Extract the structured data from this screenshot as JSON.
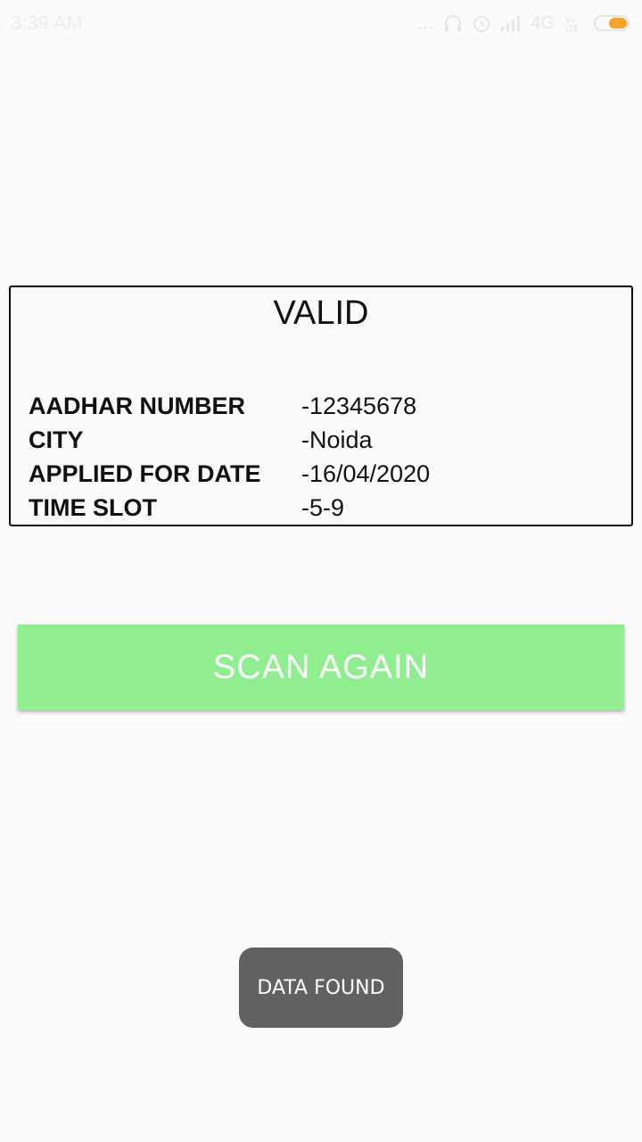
{
  "status_bar": {
    "time": "3:39 AM",
    "dots": "...",
    "network": "4G",
    "icons": [
      "headphones-icon",
      "alarm-icon",
      "signal-icon",
      "volte-icon",
      "battery-icon"
    ],
    "battery_color": "#f2a52a"
  },
  "card": {
    "title": "VALID",
    "rows": [
      {
        "label": "AADHAR NUMBER",
        "value": "-12345678"
      },
      {
        "label": "CITY",
        "value": "-Noida"
      },
      {
        "label": "APPLIED FOR DATE",
        "value": "-16/04/2020"
      },
      {
        "label": "TIME SLOT",
        "value": "-5-9"
      }
    ]
  },
  "scan_button": {
    "label": "SCAN AGAIN",
    "color": "#90ee90"
  },
  "toast": {
    "message": "DATA FOUND"
  }
}
